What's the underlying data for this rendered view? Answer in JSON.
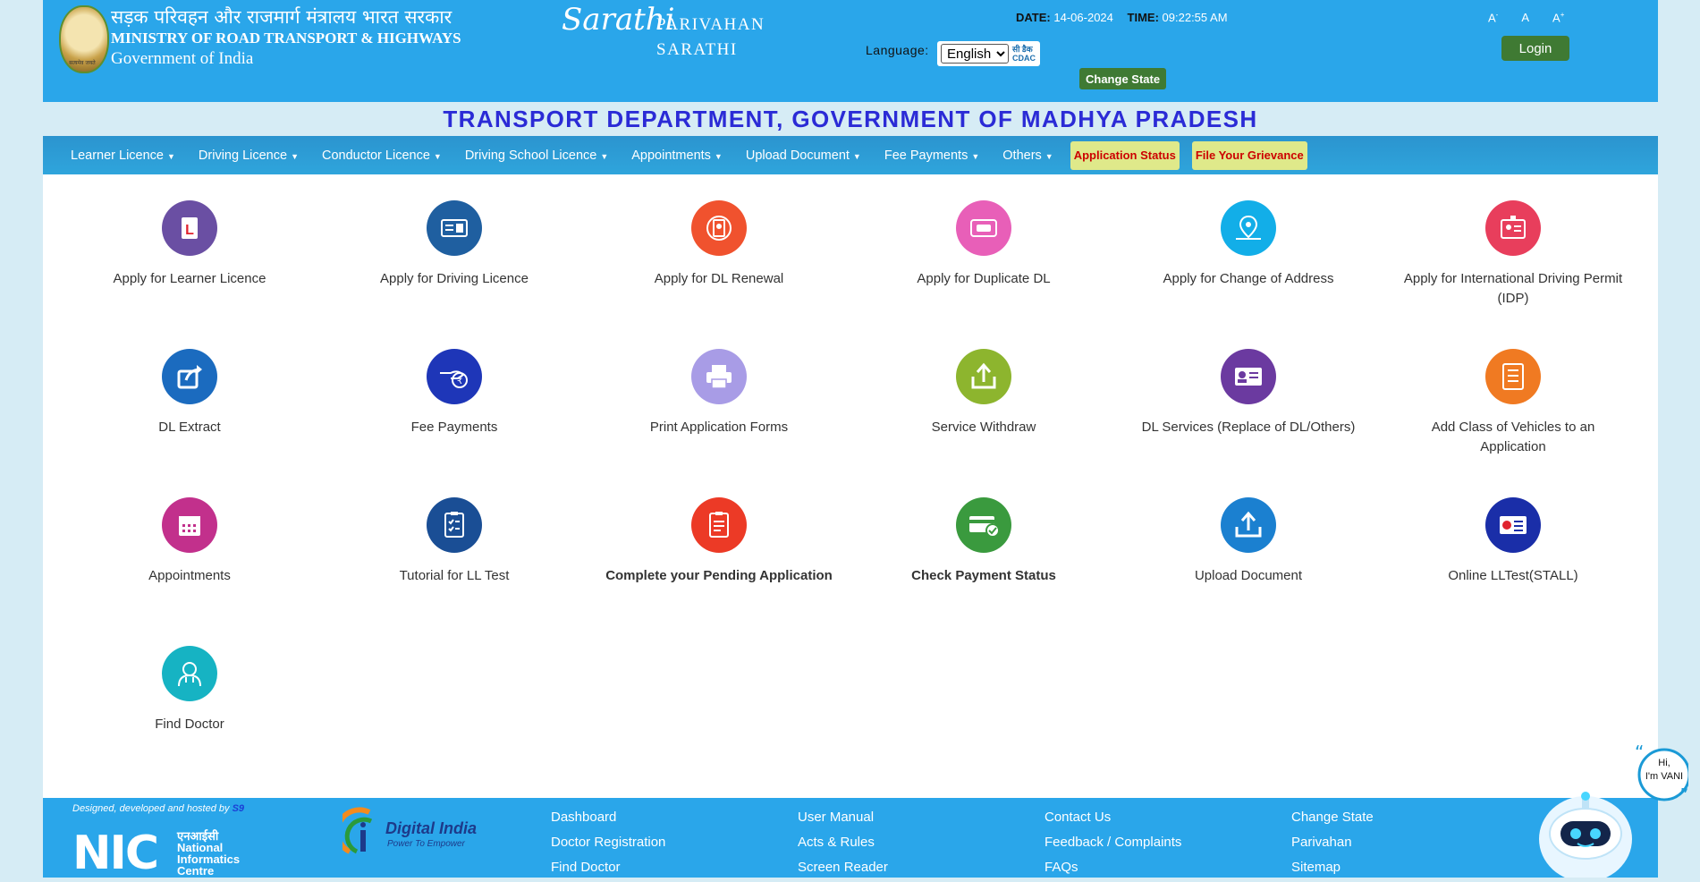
{
  "header": {
    "ministry_hindi": "सड़क परिवहन और राजमार्ग मंत्रालय भारत सरकार",
    "ministry_english": "MINISTRY OF ROAD TRANSPORT & HIGHWAYS",
    "government": "Government of India",
    "emblem_caption": "सत्यमेव जयते",
    "sarathi_script": "Sarathi",
    "brand_line1": "PARIVAHAN",
    "brand_line2": "SARATHI",
    "date_label": "DATE:",
    "date_value": "14-06-2024",
    "time_label": "TIME:",
    "time_value": "09:22:55 AM",
    "language_label": "Language:",
    "language_selected": "English",
    "cdac_label": "सी डैक\nCDAC",
    "change_state": "Change State",
    "font_small": "A",
    "font_normal": "A",
    "font_large": "A",
    "login": "Login"
  },
  "title": "TRANSPORT DEPARTMENT, GOVERNMENT OF MADHYA PRADESH",
  "nav": {
    "items": [
      "Learner Licence",
      "Driving Licence",
      "Conductor Licence",
      "Driving School Licence",
      "Appointments",
      "Upload Document",
      "Fee Payments",
      "Others"
    ],
    "application_status": "Application Status",
    "grievance": "File Your Grievance"
  },
  "services": [
    {
      "label": "Apply for Learner Licence",
      "icon": "learner-l-icon",
      "color": "#6a4fa3"
    },
    {
      "label": "Apply for Driving Licence",
      "icon": "id-card-icon",
      "color": "#1f5fa0"
    },
    {
      "label": "Apply for DL Renewal",
      "icon": "renewal-card-icon",
      "color": "#f0522e"
    },
    {
      "label": "Apply for Duplicate DL",
      "icon": "duplicate-dl-icon",
      "color": "#e85fb8"
    },
    {
      "label": "Apply for Change of Address",
      "icon": "location-pin-icon",
      "color": "#12aee8"
    },
    {
      "label": "Apply for International Driving Permit (IDP)",
      "icon": "badge-icon",
      "color": "#e83e5c"
    },
    {
      "label": "DL Extract",
      "icon": "share-icon",
      "color": "#1b6bbf"
    },
    {
      "label": "Fee Payments",
      "icon": "rupee-hand-icon",
      "color": "#1e36b8"
    },
    {
      "label": "Print Application Forms",
      "icon": "printer-icon",
      "color": "#a89ce6"
    },
    {
      "label": "Service Withdraw",
      "icon": "upload-box-icon",
      "color": "#8db52e"
    },
    {
      "label": "DL Services (Replace of DL/Others)",
      "icon": "profile-card-icon",
      "color": "#6b3aa0"
    },
    {
      "label": "Add Class of Vehicles to an Application",
      "icon": "document-list-icon",
      "color": "#f07a22"
    },
    {
      "label": "Appointments",
      "icon": "calendar-icon",
      "color": "#c2308c"
    },
    {
      "label": "Tutorial for LL Test",
      "icon": "clipboard-check-icon",
      "color": "#1a4e95"
    },
    {
      "label": "Complete your Pending Application",
      "icon": "pending-form-icon",
      "color": "#ec3a26",
      "bold": true
    },
    {
      "label": "Check Payment Status",
      "icon": "payment-card-icon",
      "color": "#3a9a3e",
      "bold": true
    },
    {
      "label": "Upload Document",
      "icon": "upload-tray-icon",
      "color": "#1b80d0"
    },
    {
      "label": "Online LLTest(STALL)",
      "icon": "online-test-icon",
      "color": "#1a2ea8"
    },
    {
      "label": "Find Doctor",
      "icon": "doctor-icon",
      "color": "#16b3c3"
    }
  ],
  "footer": {
    "designed_by": "Designed, developed and hosted by",
    "nic_link": "S9",
    "nic_logo": "NIC",
    "nic_hindi": "एनआईसी",
    "nic_line1": "National",
    "nic_line2": "Informatics",
    "nic_line3": "Centre",
    "digital_india": "Digital India",
    "digital_india_tagline": "Power To Empower",
    "col1": [
      "Dashboard",
      "Doctor Registration",
      "Find Doctor"
    ],
    "col2": [
      "User Manual",
      "Acts & Rules",
      "Screen Reader"
    ],
    "col3": [
      "Contact Us",
      "Feedback / Complaints",
      "FAQs"
    ],
    "col4": [
      "Change State",
      "Parivahan",
      "Sitemap"
    ]
  },
  "chatbot": {
    "greeting_line1": "Hi,",
    "greeting_line2": "I'm VANI"
  }
}
